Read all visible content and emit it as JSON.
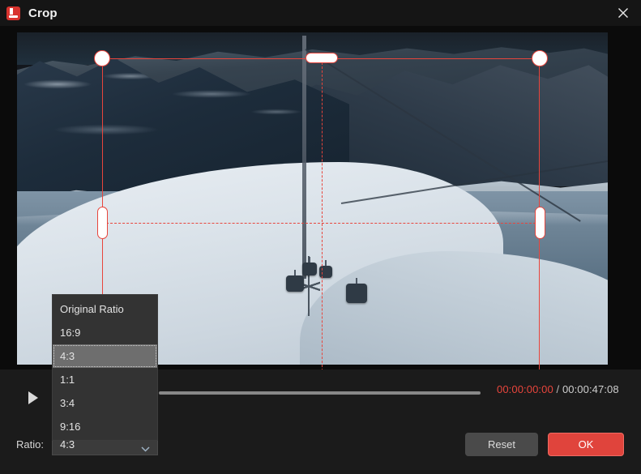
{
  "window": {
    "title": "Crop",
    "app_icon": "app-logo-icon",
    "close_icon": "close-icon"
  },
  "preview": {
    "scene_description": "Snowy mountain ski resort with gondola cable cars over a frozen lake",
    "crop_frame": {
      "border_color": "#e8453c",
      "handles": [
        "top-left-handle",
        "top-center-handle",
        "top-right-handle",
        "middle-left-handle",
        "middle-right-handle",
        "bottom-center-handle",
        "bottom-right-handle"
      ]
    }
  },
  "player": {
    "play_icon": "play-icon",
    "current_time": "00:00:00:00",
    "time_separator": "/",
    "total_time": "00:00:47:08",
    "progress_percent": 0
  },
  "bottom": {
    "ratio_label": "Ratio:",
    "ratio_value": "4:3",
    "chevron_icon": "chevron-down-icon",
    "reset_label": "Reset",
    "ok_label": "OK"
  },
  "dropdown": {
    "open": true,
    "selected": "4:3",
    "options": [
      "Original Ratio",
      "16:9",
      "4:3",
      "1:1",
      "3:4",
      "9:16"
    ]
  },
  "colors": {
    "accent_red": "#e8453c",
    "ok_button": "#e0443c",
    "window_bg": "#1b1b1b",
    "titlebar_bg": "#151515",
    "dropdown_bg": "#333333",
    "dropdown_selected": "#6e6e6e"
  }
}
